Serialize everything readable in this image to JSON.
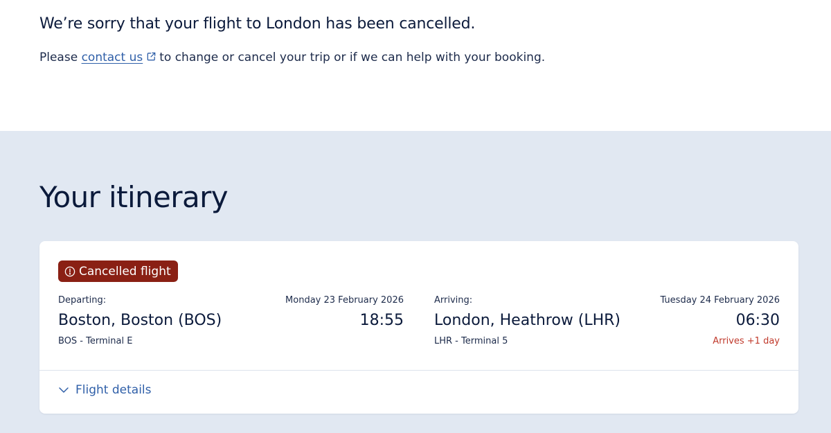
{
  "notice": {
    "headline": "We’re sorry that your flight to London has been cancelled.",
    "prefix": "Please",
    "link_label": "contact us",
    "suffix": "to change or cancel your trip or if we can help with your booking."
  },
  "itinerary": {
    "title": "Your itinerary",
    "status_badge": "Cancelled flight",
    "departing": {
      "label": "Departing:",
      "date": "Monday 23 February 2026",
      "city": "Boston, Boston (BOS)",
      "time": "18:55",
      "terminal": "BOS - Terminal E"
    },
    "arriving": {
      "label": "Arriving:",
      "date": "Tuesday 24 February 2026",
      "city": "London, Heathrow (LHR)",
      "time": "06:30",
      "terminal": "LHR - Terminal 5",
      "day_offset": "Arrives +1 day"
    },
    "details_toggle": "Flight details"
  },
  "icons": {
    "external_link": "external-link-icon",
    "alert": "alert-circle-icon",
    "chevron": "chevron-down-icon"
  },
  "colors": {
    "text_navy": "#0b1a3b",
    "link_blue": "#2f5fa8",
    "band_bg": "#e1e8f2",
    "cancel_badge": "#8a2014",
    "warning_red": "#c0392b"
  }
}
